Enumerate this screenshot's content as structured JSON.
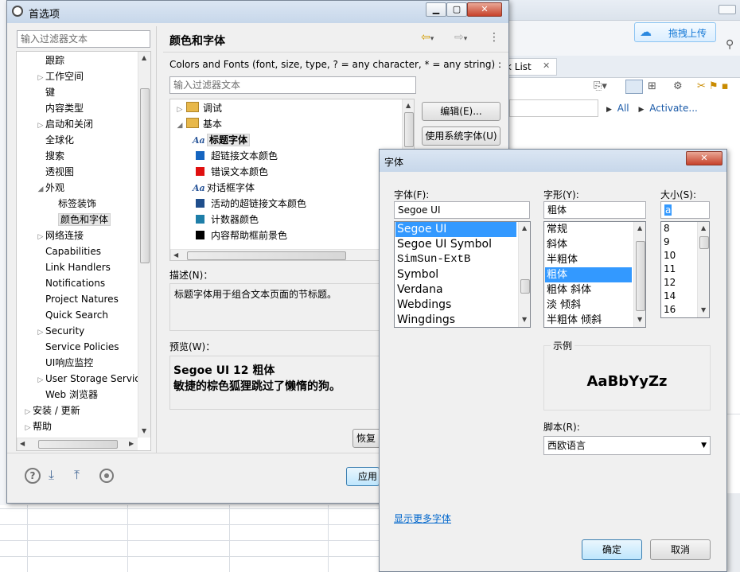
{
  "background_app": {
    "cloud_button": "拖拽上传",
    "tab_label": "k List",
    "links": [
      "All",
      "Activate..."
    ]
  },
  "prefs": {
    "title": "首选项",
    "filter_placeholder": "输入过滤器文本",
    "tree": [
      {
        "label": "跟踪",
        "indent": 1,
        "arrow": ""
      },
      {
        "label": "工作空间",
        "indent": 1,
        "arrow": "▷"
      },
      {
        "label": "键",
        "indent": 1,
        "arrow": ""
      },
      {
        "label": "内容类型",
        "indent": 1,
        "arrow": ""
      },
      {
        "label": "启动和关闭",
        "indent": 1,
        "arrow": "▷"
      },
      {
        "label": "全球化",
        "indent": 1,
        "arrow": ""
      },
      {
        "label": "搜索",
        "indent": 1,
        "arrow": ""
      },
      {
        "label": "透视图",
        "indent": 1,
        "arrow": ""
      },
      {
        "label": "外观",
        "indent": 1,
        "arrow": "◢"
      },
      {
        "label": "标签装饰",
        "indent": 2,
        "arrow": ""
      },
      {
        "label": "颜色和字体",
        "indent": 2,
        "arrow": "",
        "selected": true
      },
      {
        "label": "网络连接",
        "indent": 1,
        "arrow": "▷"
      },
      {
        "label": "Capabilities",
        "indent": 1,
        "arrow": ""
      },
      {
        "label": "Link Handlers",
        "indent": 1,
        "arrow": ""
      },
      {
        "label": "Notifications",
        "indent": 1,
        "arrow": ""
      },
      {
        "label": "Project Natures",
        "indent": 1,
        "arrow": ""
      },
      {
        "label": "Quick Search",
        "indent": 1,
        "arrow": ""
      },
      {
        "label": "Security",
        "indent": 1,
        "arrow": "▷"
      },
      {
        "label": "Service Policies",
        "indent": 1,
        "arrow": ""
      },
      {
        "label": "UI响应监控",
        "indent": 1,
        "arrow": ""
      },
      {
        "label": "User Storage Servic",
        "indent": 1,
        "arrow": "▷"
      },
      {
        "label": "Web 浏览器",
        "indent": 1,
        "arrow": ""
      },
      {
        "label": "安装 / 更新",
        "indent": 0,
        "arrow": "▷"
      },
      {
        "label": "帮助",
        "indent": 0,
        "arrow": "▷"
      }
    ],
    "page_title": "颜色和字体",
    "description_line": "Colors and Fonts (font, size, type, ? = any character, * = any string) :",
    "inner_filter_placeholder": "输入过滤器文本",
    "color_tree": [
      {
        "label": "调试",
        "kind": "folder",
        "arrow": "▷",
        "indent": 0
      },
      {
        "label": "基本",
        "kind": "folder",
        "arrow": "◢",
        "indent": 0
      },
      {
        "label": "标题字体",
        "kind": "font",
        "indent": 1,
        "selected": true
      },
      {
        "label": "超链接文本颜色",
        "kind": "color",
        "color": "#1565c0",
        "indent": 1
      },
      {
        "label": "错误文本颜色",
        "kind": "color",
        "color": "#e01010",
        "indent": 1
      },
      {
        "label": "对话框字体",
        "kind": "font",
        "indent": 1
      },
      {
        "label": "活动的超链接文本颜色",
        "kind": "color",
        "color": "#1f4e8c",
        "indent": 1
      },
      {
        "label": "计数器颜色",
        "kind": "color",
        "color": "#1e7ea8",
        "indent": 1
      },
      {
        "label": "内容帮助框前景色",
        "kind": "color",
        "color": "#000000",
        "indent": 1
      }
    ],
    "edit_button": "编辑(E)...",
    "system_font_button": "使用系统字体(U)",
    "desc_label": "描述(N)：",
    "desc_text": "标题字体用于组合文本页面的节标题。",
    "preview_label": "预览(W)：",
    "preview_line1": "Segoe UI 12 粗体",
    "preview_line2": "敏捷的棕色狐狸跳过了懒惰的狗。",
    "restore_button": "恢复",
    "apply_button": "应用"
  },
  "font_dialog": {
    "title": "字体",
    "font_label": "字体(F):",
    "font_value": "Segoe UI",
    "font_list": [
      "Segoe UI",
      "Segoe UI Symbol",
      "SimSun-ExtB",
      "Symbol",
      "Verdana",
      "Webdings",
      "Wingdings"
    ],
    "style_label": "字形(Y):",
    "style_value": "粗体",
    "style_list": [
      "常规",
      "斜体",
      "半粗体",
      "粗体",
      "粗体 斜体",
      "淡 倾斜",
      "半粗体 倾斜"
    ],
    "size_label": "大小(S):",
    "size_value": "a",
    "size_list": [
      "8",
      "9",
      "10",
      "11",
      "12",
      "14",
      "16"
    ],
    "sample_label": "示例",
    "sample_text": "AaBbYyZz",
    "script_label": "脚本(R):",
    "script_value": "西欧语言",
    "more_fonts_link": "显示更多字体",
    "ok_button": "确定",
    "cancel_button": "取消"
  }
}
